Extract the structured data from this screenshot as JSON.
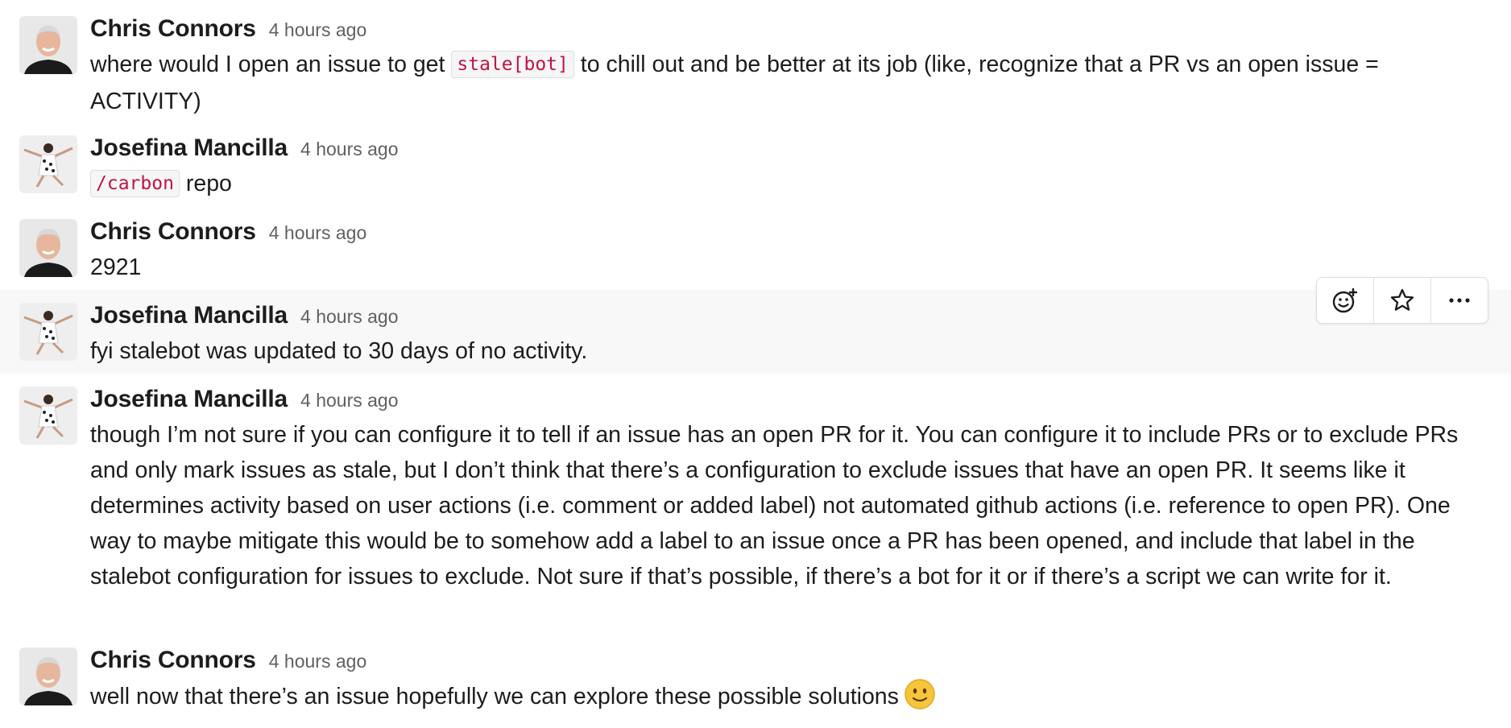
{
  "messages": [
    {
      "sender": "Chris Connors",
      "time": "4 hours ago",
      "text_before": "where would I open an issue to get",
      "code": "stale[bot]",
      "text_after": "to chill out and be better at its job (like, recognize that a PR vs an open issue = ACTIVITY)"
    },
    {
      "sender": "Josefina Mancilla",
      "time": "4 hours ago",
      "code": "/carbon",
      "text_after": "repo"
    },
    {
      "sender": "Chris Connors",
      "time": "4 hours ago",
      "text": "2921"
    },
    {
      "sender": "Josefina Mancilla",
      "time": "4 hours ago",
      "text": "fyi stalebot was updated to 30 days of no activity."
    },
    {
      "sender": "Josefina Mancilla",
      "time": "4 hours ago",
      "text": "though I’m not sure if you can configure it to tell if an issue has an open PR for it. You can configure it to include PRs or to exclude PRs and only mark issues as stale, but I don’t think that there’s a configuration to exclude issues that have an open PR. It seems like it determines activity based on user actions (i.e. comment or added label) not automated github actions (i.e. reference to open PR). One way to maybe mitigate this would be to somehow add a label to an issue once a PR has been opened, and include that label in the stalebot configuration for issues to exclude. Not sure if that’s possible, if there’s a bot for it or if there’s a script we can write for it."
    },
    {
      "sender": "Chris Connors",
      "time": "4 hours ago",
      "text": "well now that there’s an issue hopefully we can explore these possible solutions",
      "emoji": "slightly-smiling-face"
    }
  ],
  "hover_actions": [
    {
      "icon": "add-reaction-icon"
    },
    {
      "icon": "star-icon"
    },
    {
      "icon": "more-actions-icon"
    }
  ],
  "colors": {
    "code_text": "#c01343",
    "hover_background": "#f8f8f8",
    "timestamp": "#616061"
  }
}
